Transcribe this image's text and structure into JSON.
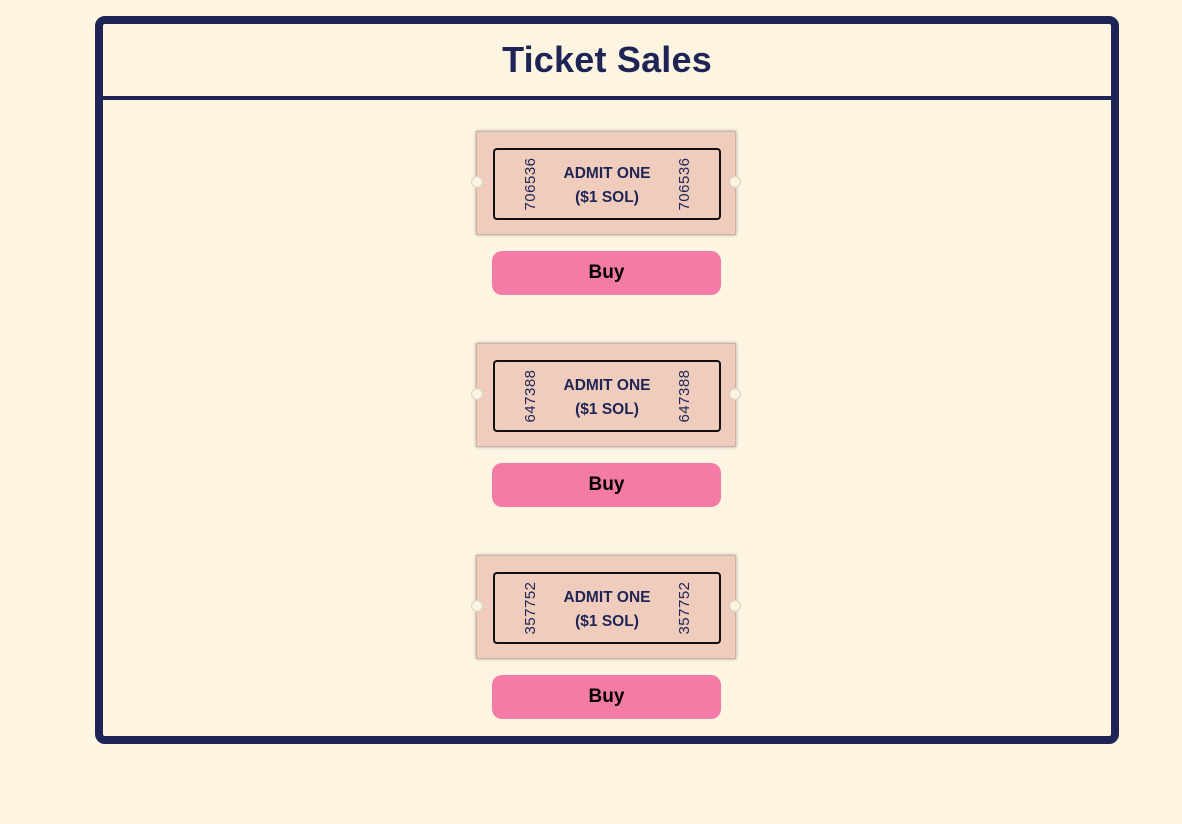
{
  "header": {
    "title": "Ticket Sales"
  },
  "tickets": [
    {
      "serial": "706536",
      "admit": "ADMIT ONE",
      "price": "($1 SOL)",
      "button_label": "Buy"
    },
    {
      "serial": "647388",
      "admit": "ADMIT ONE",
      "price": "($1 SOL)",
      "button_label": "Buy"
    },
    {
      "serial": "357752",
      "admit": "ADMIT ONE",
      "price": "($1 SOL)",
      "button_label": "Buy"
    }
  ],
  "colors": {
    "background": "#fdf5e2",
    "border_navy": "#1e2556",
    "ticket_fill": "#efccbb",
    "button_pink": "#f37ba6"
  }
}
